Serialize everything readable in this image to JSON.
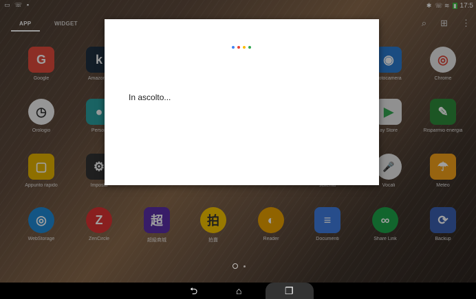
{
  "status_bar": {
    "left_icons": [
      "notification-icon",
      "phone-icon",
      "storage-icon"
    ],
    "right_icons": [
      "bluetooth-icon",
      "phone-icon",
      "wifi-icon",
      "battery-icon"
    ],
    "time": "17:5"
  },
  "tabs": [
    {
      "label": "APP",
      "active": true
    },
    {
      "label": "WIDGET",
      "active": false
    }
  ],
  "top_icons": [
    "search-icon",
    "grid-view-icon",
    "overflow-menu-icon"
  ],
  "apps": [
    {
      "label": "Google",
      "icon": "google-folder-icon",
      "color": "#d44",
      "glyph": "G"
    },
    {
      "label": "Amazon K",
      "icon": "kindle-icon",
      "color": "#1f2f3f",
      "glyph": "k"
    },
    {
      "label": "Fotocamera",
      "icon": "camera-icon",
      "color": "#2a7bd0",
      "glyph": "◉"
    },
    {
      "label": "Chrome",
      "icon": "chrome-icon",
      "color": "#e8e8e8",
      "glyph": "◎"
    },
    {
      "label": "Orologio",
      "icon": "clock-icon",
      "color": "#f2f2f2",
      "glyph": "◷"
    },
    {
      "label": "Person",
      "icon": "people-icon",
      "color": "#2aa0a0",
      "glyph": "●"
    },
    {
      "label": "ay Store",
      "icon": "play-store-icon",
      "color": "#e8e8e8",
      "glyph": "▶"
    },
    {
      "label": "Risparmio energia",
      "icon": "power-saver-icon",
      "color": "#2e8b3a",
      "glyph": "✎"
    },
    {
      "label": "Appunto rapido",
      "icon": "quick-memo-icon",
      "color": "#e5b400",
      "glyph": "▢"
    },
    {
      "label": "Imposta",
      "icon": "settings-icon",
      "color": "#333",
      "glyph": "⚙"
    },
    {
      "label": "sistema",
      "icon": "system-icon",
      "color": "transparent",
      "glyph": ""
    },
    {
      "label": "Vocali",
      "icon": "voice-search-icon",
      "color": "#e8e8e8",
      "glyph": "🎤"
    },
    {
      "label": "Meteo",
      "icon": "weather-icon",
      "color": "#f4a21a",
      "glyph": "☂"
    },
    {
      "label": "WebStorage",
      "icon": "webstorage-icon",
      "color": "#1f8ad6",
      "glyph": "◎"
    },
    {
      "label": "ZenCircle",
      "icon": "zencircle-icon",
      "color": "#d33",
      "glyph": "Z"
    },
    {
      "label": "超級商城",
      "icon": "yahoo-mall-icon",
      "color": "#5b2fa8",
      "glyph": "超"
    },
    {
      "label": "拍賣",
      "icon": "yahoo-auction-icon",
      "color": "#f5c400",
      "glyph": "拍"
    },
    {
      "label": "Reader",
      "icon": "reader-icon",
      "color": "#e8a000",
      "glyph": "◐"
    },
    {
      "label": "Documenti",
      "icon": "docs-icon",
      "color": "#3f7de0",
      "glyph": "≡"
    },
    {
      "label": "Share Link",
      "icon": "share-link-icon",
      "color": "#1ea34a",
      "glyph": "∞"
    },
    {
      "label": "Backup",
      "icon": "backup-icon",
      "color": "#3a5fb0",
      "glyph": "⟳"
    }
  ],
  "dialog": {
    "listening_text": "In ascolto...",
    "dot_colors": [
      "#4285f4",
      "#ea4335",
      "#fbbc05",
      "#34a853"
    ]
  },
  "page_indicator": {
    "home_icon": "home-page-icon",
    "pages": 2
  },
  "navbar": {
    "back_icon": "back-icon",
    "home_icon": "home-icon",
    "recent_icon": "recent-apps-icon"
  }
}
